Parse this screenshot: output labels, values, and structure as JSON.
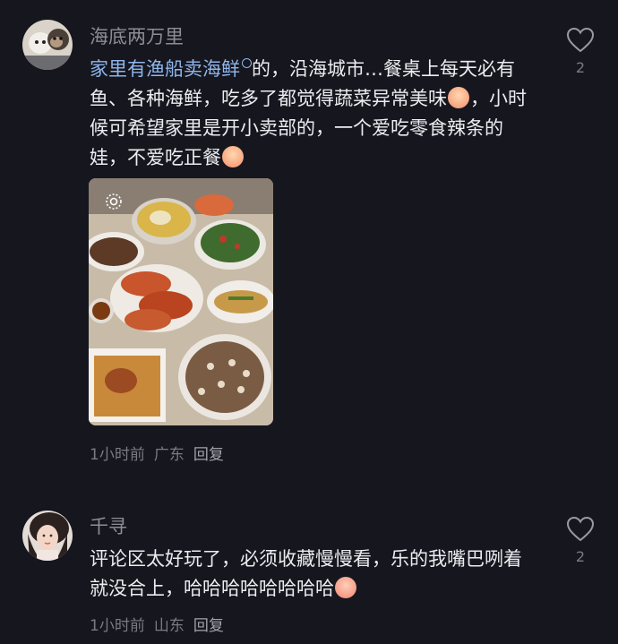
{
  "comments": [
    {
      "username": "海底两万里",
      "text_link": "家里有渔船卖海鲜",
      "text_part1": "的，沿海城市…餐桌上每天必有鱼、各种海鲜，吃多了都觉得蔬菜异常美味",
      "text_part2": "，小时候可希望家里是开小卖部的，一个爱吃零食辣条的娃，不爱吃正餐",
      "emoji1": "loudly-crying-emoji",
      "emoji2": "loudly-crying-emoji",
      "time": "1小时前",
      "location": "广东",
      "reply_label": "回复",
      "like_count": "2"
    },
    {
      "username": "千寻",
      "text": "评论区太好玩了，必须收藏慢慢看，乐的我嘴巴咧着就没合上，哈哈哈哈哈哈哈哈",
      "emoji": "laughing-emoji",
      "time": "1小时前",
      "location": "山东",
      "reply_label": "回复",
      "like_count": "2"
    }
  ],
  "colors": {
    "background": "#16161e",
    "link": "#8fb6ec",
    "username": "#8d8d96",
    "meta": "#7a7a84"
  }
}
